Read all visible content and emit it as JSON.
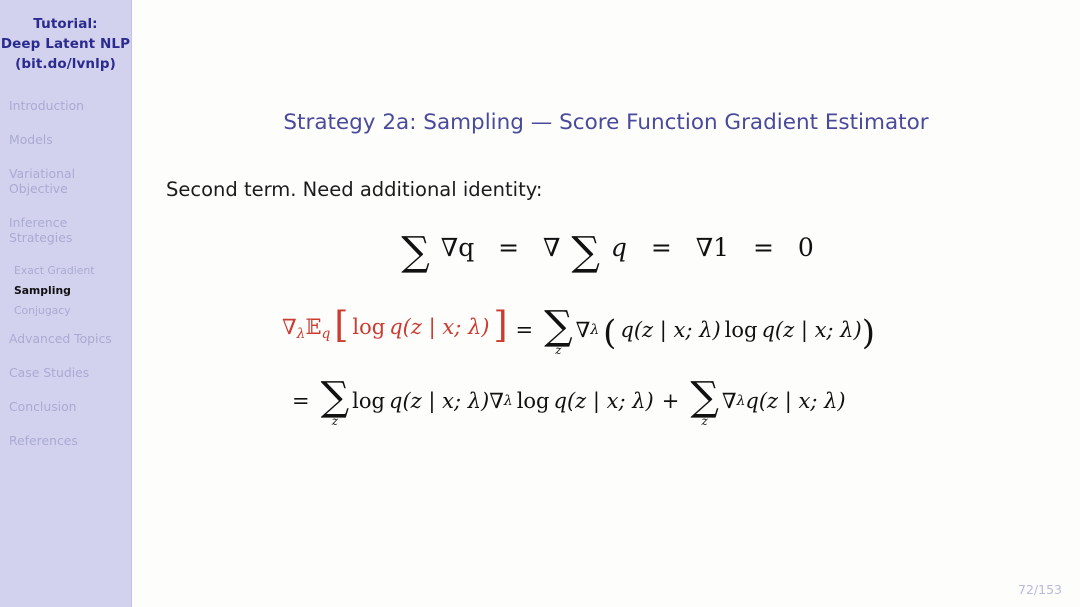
{
  "sidebar": {
    "title_lines": [
      "Tutorial:",
      "Deep Latent NLP",
      "(bit.do/lvnlp)"
    ],
    "items": [
      {
        "label": "Introduction",
        "label2": ""
      },
      {
        "label": "Models",
        "label2": ""
      },
      {
        "label": "Variational",
        "label2": "Objective"
      },
      {
        "label": "Inference",
        "label2": "Strategies"
      },
      {
        "label": "Advanced Topics",
        "label2": ""
      },
      {
        "label": "Case Studies",
        "label2": ""
      },
      {
        "label": "Conclusion",
        "label2": ""
      },
      {
        "label": "References",
        "label2": ""
      }
    ],
    "subitems": [
      {
        "label": "Exact Gradient",
        "active": false
      },
      {
        "label": "Sampling",
        "active": true
      },
      {
        "label": "Conjugacy",
        "active": false
      }
    ],
    "colors": {
      "background": "#d2d2ee",
      "title_text": "#2b2b8f",
      "item_text": "#aaaad4",
      "active_text": "#111111"
    }
  },
  "slide": {
    "title": "Strategy 2a: Sampling — Score Function Gradient Estimator",
    "title_color": "#4a4a9c",
    "lead_text": "Second term.  Need additional identity:",
    "page_number": "72/153",
    "page_number_color": "#b9b9dd",
    "highlight_color": "#cb3b30"
  },
  "equations": {
    "identity": {
      "plain": "∑ ∇q = ∇ ∑ q = ∇1 = 0",
      "parts": {
        "sum1": "∑",
        "nabla_q": "∇q",
        "eq1": "=",
        "nabla2": "∇",
        "sum2": "∑",
        "q": "q",
        "eq2": "=",
        "nabla_one": "∇1",
        "eq3": "=",
        "zero": "0"
      }
    },
    "derivation_line1": {
      "plain": "∇_λ E_q[ log q(z | x; λ) ] = ∑_z ∇_λ ( q(z | x; λ) log q(z | x; λ) )",
      "lhs": {
        "nabla": "∇",
        "nabla_sub": "λ",
        "expect": "𝔼",
        "expect_sub": "q",
        "bracket_open": "[",
        "log": "log",
        "q": "q",
        "args": "(z | x; λ)",
        "bracket_close": "]"
      },
      "equals": "=",
      "rhs": {
        "sum": "∑",
        "sum_sub": "z",
        "nabla": "∇",
        "nabla_sub": "λ",
        "paren_open": "(",
        "term1_q": "q",
        "term1_args": "(z | x; λ)",
        "log": "log",
        "term2_q": "q",
        "term2_args": "(z | x; λ)",
        "paren_close": ")"
      }
    },
    "derivation_line2": {
      "plain": "= ∑_z log q(z | x; λ) ∇_λ log q(z | x; λ) + ∑_z ∇_λ q(z | x; λ)",
      "equals": "=",
      "sum1": "∑",
      "sum1_sub": "z",
      "log1": "log",
      "q1": "q",
      "args1": "(z | x; λ)",
      "nabla": "∇",
      "nabla_sub": "λ",
      "log2": "log",
      "q2": "q",
      "args2": "(z | x; λ)",
      "plus": "+",
      "sum2": "∑",
      "sum2_sub": "z",
      "nabla2": "∇",
      "nabla2_sub": "λ",
      "q3": "q",
      "args3": "(z | x; λ)"
    }
  }
}
